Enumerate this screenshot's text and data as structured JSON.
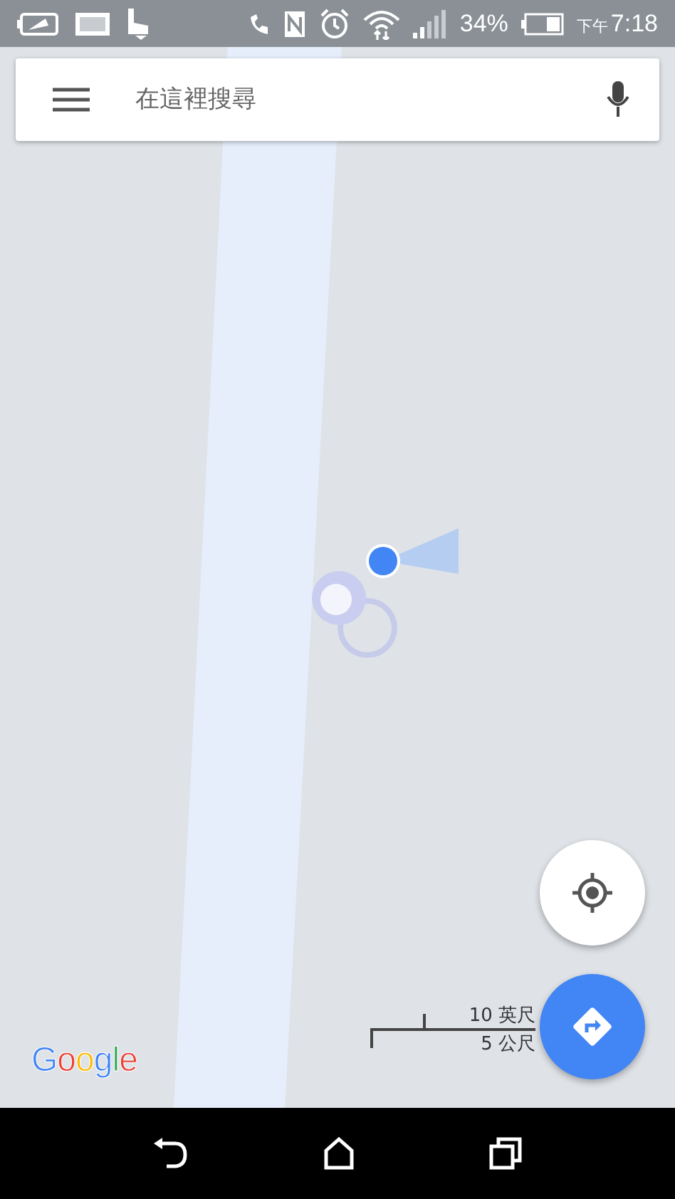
{
  "status_bar": {
    "battery_percent": "34%",
    "period": "下午",
    "time": "7:18"
  },
  "search": {
    "placeholder": "在這裡搜尋"
  },
  "scale": {
    "imperial": "10 英尺",
    "metric": "5 公尺"
  },
  "logo": "Google"
}
